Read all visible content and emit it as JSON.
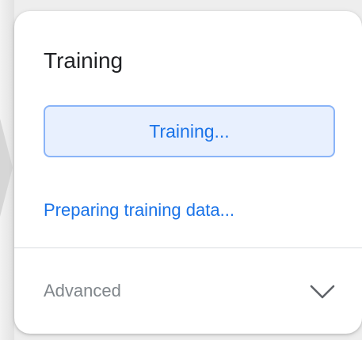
{
  "panel": {
    "title": "Training",
    "train_button_label": "Training...",
    "status_text": "Preparing training data...",
    "advanced_label": "Advanced",
    "advanced_icon": "chevron-down-icon"
  },
  "colors": {
    "accent": "#1a73e8",
    "button_bg": "#e8f0fe",
    "button_border": "#8ab4f8",
    "muted_text": "#80868b"
  }
}
